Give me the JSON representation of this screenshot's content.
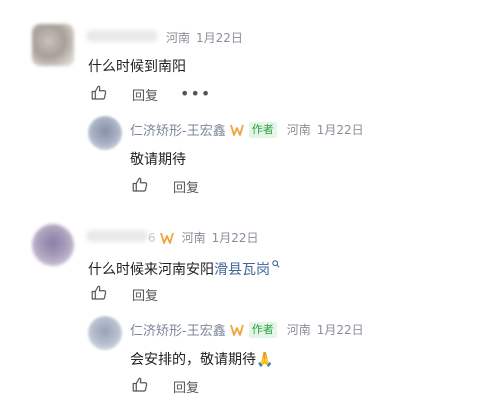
{
  "comments": [
    {
      "meta": {
        "ip": "河南",
        "date": "1月22日"
      },
      "text": "什么时候到南阳",
      "actions": {
        "reply": "回复",
        "more": "•••"
      },
      "reply": {
        "name": "仁济矫形-王宏鑫",
        "badge": "作者",
        "ip": "河南",
        "date": "1月22日",
        "text": "敬请期待",
        "actions": {
          "reply": "回复"
        }
      }
    },
    {
      "meta": {
        "prefix": "6",
        "ip": "河南",
        "date": "1月22日"
      },
      "text_plain": "什么时候来河南安阳",
      "text_highlight": "滑县瓦岗",
      "actions": {
        "reply": "回复"
      },
      "reply": {
        "name": "仁济矫形-王宏鑫",
        "badge": "作者",
        "ip": "河南",
        "date": "1月22日",
        "text": "会安排的，敬请期待🙏",
        "actions": {
          "reply": "回复"
        }
      }
    }
  ],
  "colors": {
    "highlight": "#406599",
    "author_badge_text": "#2aa043",
    "author_badge_bg": "#e5f6e8",
    "meta": "#8a8f99",
    "author_name": "#7c8699"
  }
}
